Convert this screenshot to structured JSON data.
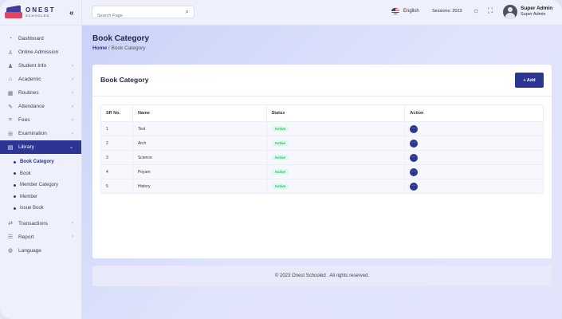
{
  "app": {
    "logo_title": "ONEST",
    "logo_sub": "SCHOOLED",
    "collapse_icon": "double-chevron-left-icon"
  },
  "sidebar": {
    "items": [
      {
        "label": "Dashboard",
        "icon": "dashboard-icon",
        "has_children": false,
        "active": false
      },
      {
        "label": "Online Admission",
        "icon": "user-icon",
        "has_children": false,
        "active": false
      },
      {
        "label": "Student Info",
        "icon": "users-icon",
        "has_children": true,
        "active": false
      },
      {
        "label": "Academic",
        "icon": "graduation-cap-icon",
        "has_children": true,
        "active": false
      },
      {
        "label": "Routines",
        "icon": "calendar-icon",
        "has_children": true,
        "active": false
      },
      {
        "label": "Attendance",
        "icon": "pen-icon",
        "has_children": true,
        "active": false
      },
      {
        "label": "Fees",
        "icon": "money-icon",
        "has_children": true,
        "active": false
      },
      {
        "label": "Examination",
        "icon": "exam-icon",
        "has_children": true,
        "active": false
      },
      {
        "label": "Library",
        "icon": "book-icon",
        "has_children": true,
        "active": true
      }
    ],
    "library_sub": [
      {
        "label": "Book Category",
        "active": true
      },
      {
        "label": "Book",
        "active": false
      },
      {
        "label": "Member Category",
        "active": false
      },
      {
        "label": "Member",
        "active": false
      },
      {
        "label": "Issue Book",
        "active": false
      }
    ],
    "items_after": [
      {
        "label": "Transactions",
        "icon": "transaction-icon",
        "has_children": true
      },
      {
        "label": "Report",
        "icon": "report-icon",
        "has_children": true
      },
      {
        "label": "Language",
        "icon": "language-icon",
        "has_children": false
      }
    ]
  },
  "header": {
    "search_placeholder": "Search Page",
    "language": "English",
    "session": "Sessions: 2023",
    "user_name": "Super Admin",
    "user_role": "Super Admin"
  },
  "page": {
    "title": "Book Category",
    "breadcrumb_home": "Home",
    "breadcrumb_sep": "/",
    "breadcrumb_current": "Book Category",
    "card_title": "Book Category",
    "add_label": "+ Add",
    "columns": [
      "SR No.",
      "Name",
      "Status",
      "Action"
    ],
    "rows": [
      {
        "sr": "1",
        "name": "Test",
        "status": "Active",
        "action": "⋯"
      },
      {
        "sr": "2",
        "name": "Arch",
        "status": "Active",
        "action": "⋯"
      },
      {
        "sr": "3",
        "name": "Science",
        "status": "Active",
        "action": "⋯"
      },
      {
        "sr": "4",
        "name": "Poyam",
        "status": "Active",
        "action": "⋯"
      },
      {
        "sr": "5",
        "name": "History",
        "status": "Active",
        "action": "⋯"
      }
    ],
    "footer": "© 2023 Onest Schooled . All rights reserved."
  },
  "colors": {
    "primary": "#2d3494",
    "active_badge_bg": "#e3f8ec",
    "active_badge_text": "#2bb673"
  }
}
